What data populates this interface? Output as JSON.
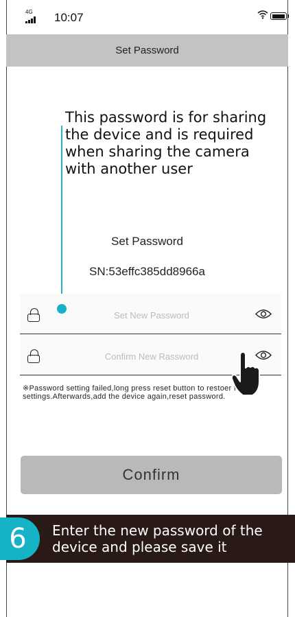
{
  "status_bar": {
    "network": "4G",
    "time": "10:07"
  },
  "header": {
    "title": "Set Password"
  },
  "annotation": {
    "text": "This password is for sharing the device and is required when sharing the camera with another user"
  },
  "form": {
    "title": "Set Password",
    "serial": "SN:53effc385dd8966a",
    "new_password_placeholder": "Set New Password",
    "confirm_password_placeholder": "Confirm New Rassword",
    "warning": "※Password setting failed,long press reset button to restoer factory settings.Afterwards,add the device again,reset password.",
    "confirm_label": "Confirm"
  },
  "step": {
    "number": "6",
    "text": "Enter the new password of the device and please save it"
  },
  "colors": {
    "accent": "#16b2c5",
    "header_bg": "#c3c3c3",
    "button_bg": "#b9b9b9",
    "banner_bg": "#2a1a17"
  }
}
